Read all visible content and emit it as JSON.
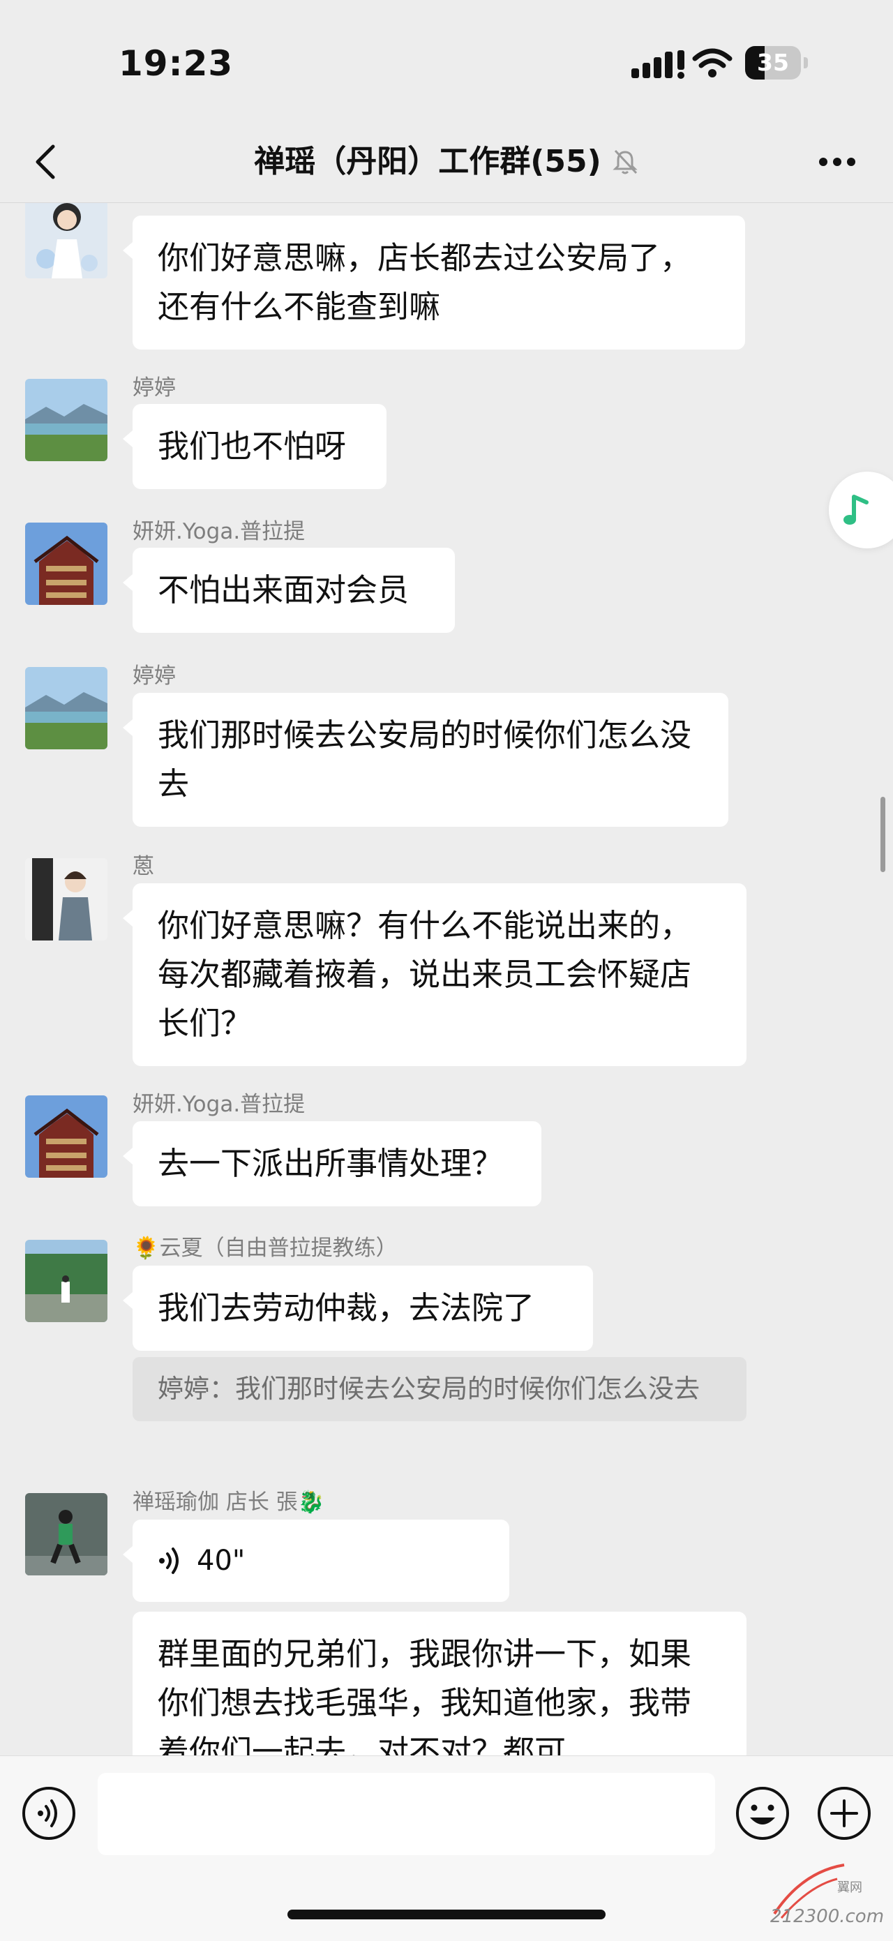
{
  "status_bar": {
    "time": "19:23",
    "battery": "35",
    "battery_level": 0.35
  },
  "header": {
    "title": "禅瑶（丹阳）工作群(55)"
  },
  "messages": [
    {
      "sender": "",
      "text": "你们好意思嘛，店长都去过公安局了，还有什么不能查到嘛"
    },
    {
      "sender": "婷婷",
      "text": "我们也不怕呀"
    },
    {
      "sender": "妍妍.Yoga.普拉提",
      "text": "不怕出来面对会员"
    },
    {
      "sender": "婷婷",
      "text": "我们那时候去公安局的时候你们怎么没去"
    },
    {
      "sender": "蒽",
      "text": "你们好意思嘛？有什么不能说出来的，每次都藏着掖着，说出来员工会怀疑店长们？"
    },
    {
      "sender": "妍妍.Yoga.普拉提",
      "text": "去一下派出所事情处理？"
    },
    {
      "sender": "🌻云夏（自由普拉提教练）",
      "text": "我们去劳动仲裁，去法院了",
      "quote": "婷婷：我们那时候去公安局的时候你们怎么没去"
    },
    {
      "sender": "禅瑶瑜伽  店长 張🐉",
      "voice_duration": "40\"",
      "text": "群里面的兄弟们，我跟你讲一下，如果你们想去找毛强华，我知道他家，我带着你们一起去，对不对？都可"
    }
  ],
  "input": {
    "placeholder": ""
  },
  "watermark": {
    "site": "212300.com",
    "brand": "翼网"
  },
  "colors": {
    "background": "#ededed",
    "bubble": "#ffffff",
    "accent": "#07c160"
  }
}
